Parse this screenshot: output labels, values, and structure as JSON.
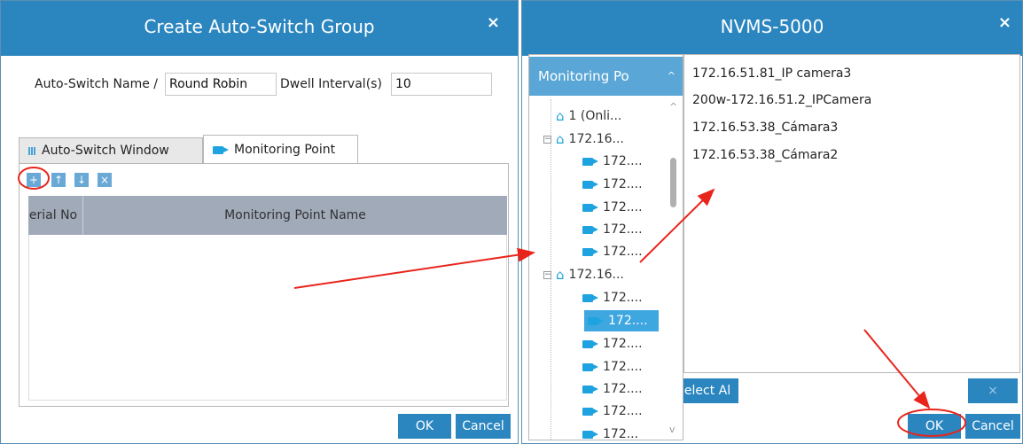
{
  "left_dialog": {
    "title": "Create Auto-Switch Group",
    "close_symbol": "×",
    "name_label": "Auto-Switch Name /",
    "name_value": "Round Robin",
    "dwell_label": "Dwell Interval(s)",
    "dwell_value": "10",
    "tabs": [
      {
        "label": "Auto-Switch Window",
        "icon": "grid-icon",
        "active": false
      },
      {
        "label": "Monitoring Point",
        "icon": "camera-icon",
        "active": true
      }
    ],
    "toolbar_icons": [
      "add-icon",
      "move-up-icon",
      "move-down-icon",
      "delete-icon"
    ],
    "columns": [
      "Serial No",
      "Monitoring Point Name"
    ],
    "rows": [],
    "ok_label": "OK",
    "cancel_label": "Cancel"
  },
  "right_dialog": {
    "title": "NVMS-5000",
    "close_symbol": "×",
    "tree_header": "Monitoring Po",
    "tree": [
      {
        "label": "1 (Onli...",
        "type": "site"
      },
      {
        "label": "172.16...",
        "type": "site"
      },
      {
        "label": "172....",
        "type": "camera"
      },
      {
        "label": "172....",
        "type": "camera"
      },
      {
        "label": "172....",
        "type": "camera"
      },
      {
        "label": "172....",
        "type": "camera"
      },
      {
        "label": "172....",
        "type": "camera"
      },
      {
        "label": "172.16...",
        "type": "site"
      },
      {
        "label": "172....",
        "type": "camera"
      },
      {
        "label": "172....",
        "type": "camera",
        "selected": true
      },
      {
        "label": "172....",
        "type": "camera"
      },
      {
        "label": "172....",
        "type": "camera"
      },
      {
        "label": "172....",
        "type": "camera"
      },
      {
        "label": "172....",
        "type": "camera"
      },
      {
        "label": "172...",
        "type": "camera"
      }
    ],
    "selected_list": [
      "172.16.51.81_IP camera3",
      "200w-172.16.51.2_IPCamera",
      "172.16.53.38_Cámara3",
      "172.16.53.38_Cámara2"
    ],
    "select_all_label": "Select Al",
    "delete_symbol": "×",
    "ok_label": "OK",
    "cancel_label": "Cancel"
  },
  "colors": {
    "titlebar": "#2b86c0",
    "button": "#2b86c0",
    "annotation": "#e8251c"
  }
}
